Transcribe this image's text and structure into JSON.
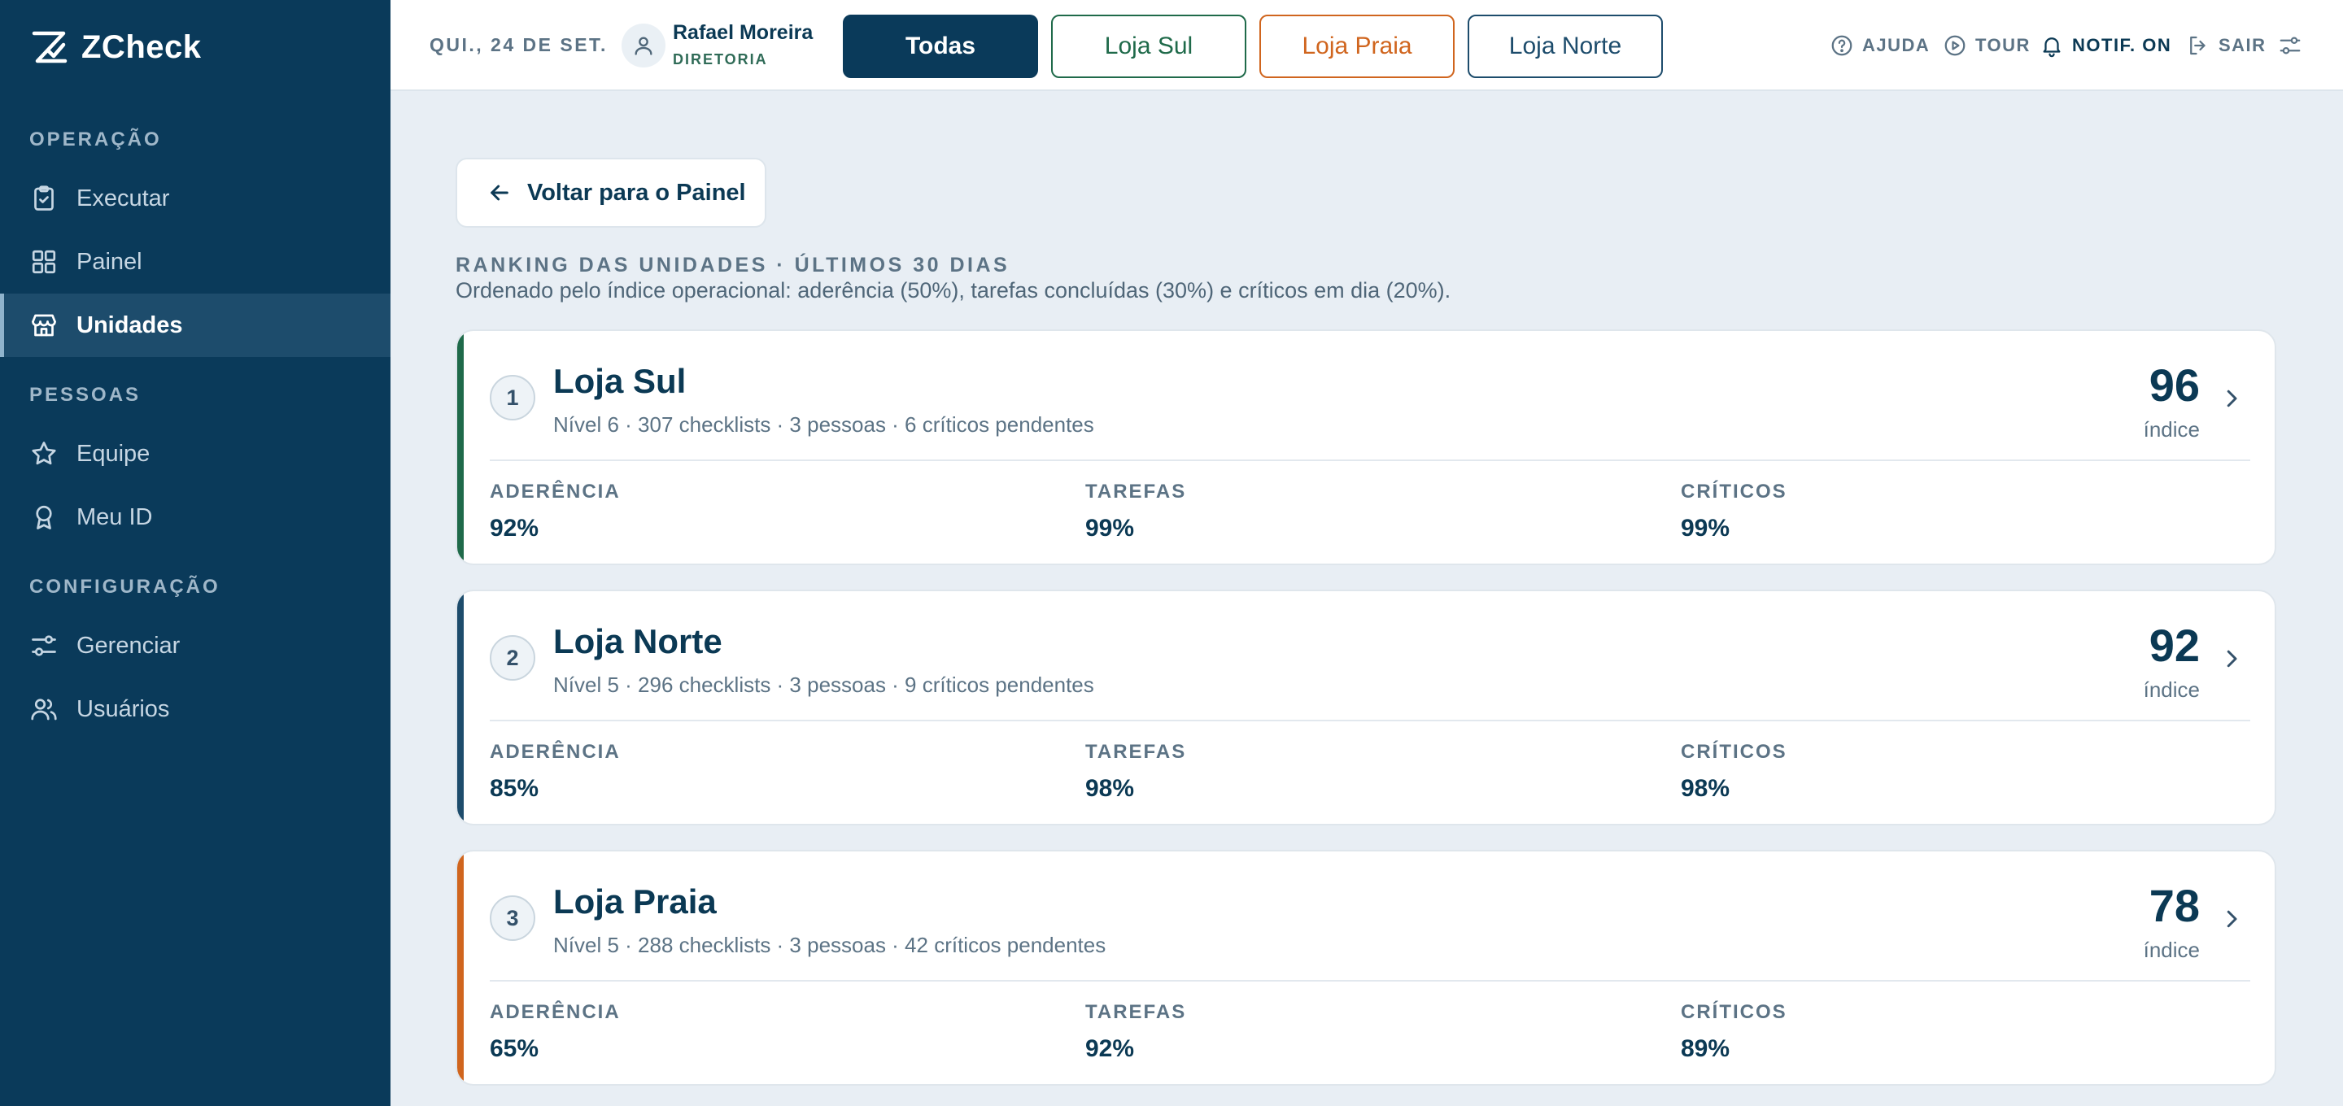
{
  "brand": {
    "name": "ZCheck"
  },
  "sidebar": {
    "sections": [
      {
        "title": "OPERAÇÃO",
        "items": [
          {
            "label": "Executar",
            "icon": "clipboard-check-icon"
          },
          {
            "label": "Painel",
            "icon": "grid-icon"
          },
          {
            "label": "Unidades",
            "icon": "store-icon",
            "active": true
          }
        ]
      },
      {
        "title": "PESSOAS",
        "items": [
          {
            "label": "Equipe",
            "icon": "star-icon"
          },
          {
            "label": "Meu ID",
            "icon": "badge-icon"
          }
        ]
      },
      {
        "title": "CONFIGURAÇÃO",
        "items": [
          {
            "label": "Gerenciar",
            "icon": "sliders-icon"
          },
          {
            "label": "Usuários",
            "icon": "users-icon"
          }
        ]
      }
    ]
  },
  "topbar": {
    "date": "QUI., 24 DE SET.",
    "user": {
      "name": "Rafael Moreira",
      "role": "DIRETORIA"
    },
    "stores": [
      "Todas",
      "Loja Sul",
      "Loja Praia",
      "Loja Norte"
    ],
    "selected_store": "Todas",
    "tools": {
      "help": "AJUDA",
      "tour": "TOUR",
      "notif": "NOTIF. ON",
      "logout": "SAIR"
    }
  },
  "main": {
    "back_label": "Voltar para o Painel",
    "title": "RANKING DAS UNIDADES · ÚLTIMOS 30 DIAS",
    "subtitle": "Ordenado pelo índice operacional: aderência (50%), tarefas concluídas (30%) e críticos em dia (20%).",
    "score_label": "índice",
    "metric_labels": {
      "adherence": "ADERÊNCIA",
      "tasks": "TAREFAS",
      "critical": "CRÍTICOS"
    },
    "ranking": [
      {
        "rank": "1",
        "name": "Loja Sul",
        "meta": "Nível 6 · 307 checklists · 3 pessoas · 6 críticos pendentes",
        "score": "96",
        "adherence": "92%",
        "tasks": "99%",
        "critical": "99%",
        "color": "#1f6a4a"
      },
      {
        "rank": "2",
        "name": "Loja Norte",
        "meta": "Nível 5 · 296 checklists · 3 pessoas · 9 críticos pendentes",
        "score": "92",
        "adherence": "85%",
        "tasks": "98%",
        "critical": "98%",
        "color": "#1d4c6c"
      },
      {
        "rank": "3",
        "name": "Loja Praia",
        "meta": "Nível 5 · 288 checklists · 3 pessoas · 42 críticos pendentes",
        "score": "78",
        "adherence": "65%",
        "tasks": "92%",
        "critical": "89%",
        "color": "#d0651e"
      }
    ]
  },
  "colors": {
    "sidebar": "#0a3a5a",
    "primary": "#0b3954",
    "sul": "#1f6a4a",
    "praia": "#d0651e",
    "norte": "#1d4c6c"
  }
}
